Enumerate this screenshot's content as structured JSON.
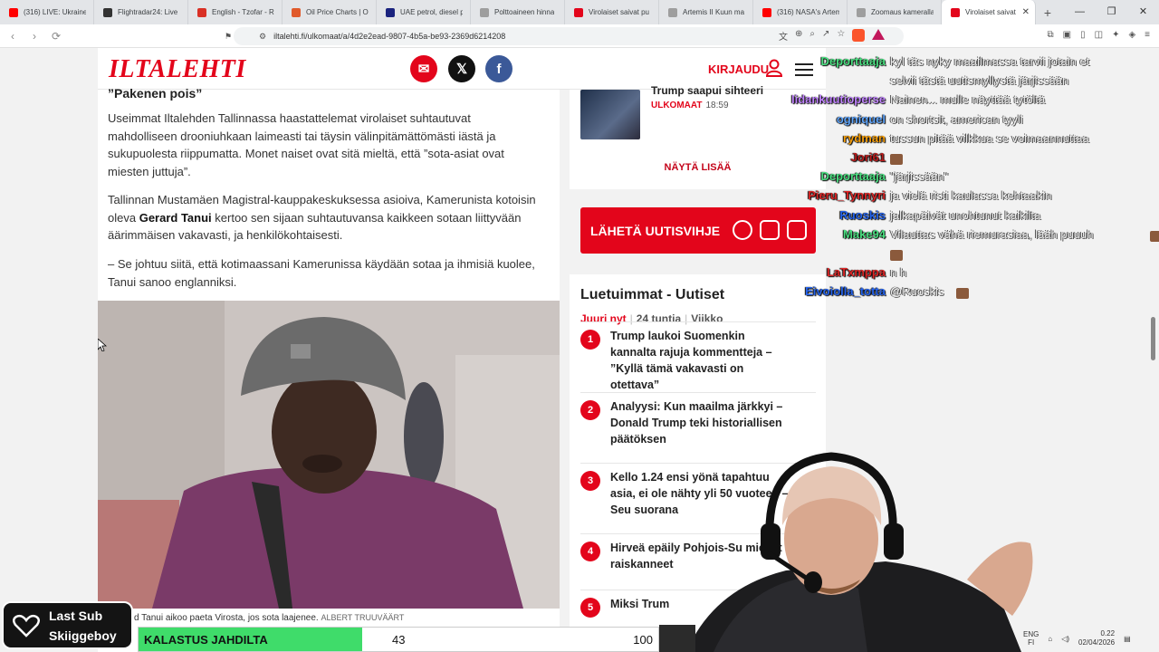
{
  "tabs": [
    {
      "title": "(316) LIVE: Ukraine",
      "fav": "#ff0000"
    },
    {
      "title": "Flightradar24: Live F",
      "fav": "#333333"
    },
    {
      "title": "English - Tzofar - Re",
      "fav": "#d93025"
    },
    {
      "title": "Oil Price Charts | Oil",
      "fav": "#e05a2b"
    },
    {
      "title": "UAE petrol, diesel p",
      "fav": "#1a237e"
    },
    {
      "title": "Polttoaineen hinna",
      "fav": "#9e9e9e"
    },
    {
      "title": "Virolaiset saivat pu",
      "fav": "#e3051b"
    },
    {
      "title": "Artemis II Kuun ma",
      "fav": "#9e9e9e"
    },
    {
      "title": "(316) NASA's Artem",
      "fav": "#ff0000"
    },
    {
      "title": "Zoomaus kameralla",
      "fav": "#9e9e9e"
    },
    {
      "title": "Virolaiset saivat",
      "fav": "#e3051b"
    }
  ],
  "address": {
    "url": "iltalehti.fi/ulkomaat/a/4d2e2ead-9807-4b5a-be93-2369d6214208"
  },
  "site": {
    "logo": "ILTALEHTI",
    "login": "KIRJAUDU"
  },
  "article": {
    "subhead": "”Pakenen pois”",
    "p1": "Useimmat Iltalehden Tallinnassa haastattelemat virolaiset suhtautuvat mahdolliseen drooniuhkaan laimeasti tai täysin välinpitämättömästi iästä ja sukupuolesta riippumatta. Monet naiset ovat sitä mieltä, että ”sota-asiat ovat miesten juttuja”.",
    "p2_before": "Tallinnan Mustamäen Magistral-kauppakeskuksessa asioiva, Kamerunista kotoisin oleva ",
    "p2_name": "Gerard Tanui",
    "p2_after": " kertoo sen sijaan suhtautuvansa kaikkeen sotaan liittyvään äärimmäisen vakavasti, ja henkilökohtaisesti.",
    "p3": "– Se johtuu siitä, että kotimaassani Kamerunissa käydään sotaa ja ihmisiä kuolee, Tanui sanoo englanniksi.",
    "caption_text": "d Tanui aikoo paeta Virosta, jos sota laajenee.",
    "caption_credit": "ALBERT TRUUVÄÄRT"
  },
  "sidebar": {
    "top_title": "Trump saapui sihteeri",
    "top_tag": "ULKOMAAT",
    "top_time": "18:59",
    "more": "NÄYTÄ LISÄÄ",
    "tip": "LÄHETÄ UUTISVIHJE",
    "most_read_title": "Luetuimmat - Uutiset",
    "tabs": [
      "Juuri nyt",
      "24 tuntia",
      "Viikko"
    ],
    "items": [
      {
        "n": "1",
        "text": "Trump laukoi Suomenkin kannalta rajuja kommentteja – ”Kyllä tämä vakavasti on otettava”"
      },
      {
        "n": "2",
        "text": "Analyysi: Kun maailma järkkyi – Donald Trump teki historiallisen päätöksen"
      },
      {
        "n": "3",
        "text": "Kello 1.24 ensi yönä tapahtuu asia, ei ole nähty yli 50 vuoteen – Seu suorana"
      },
      {
        "n": "4",
        "text": "Hirveä epäily Pohjois-Su miehet raiskanneet"
      },
      {
        "n": "5",
        "text": "Miksi Trum"
      }
    ]
  },
  "chat": [
    {
      "user": "Deporttaaja",
      "color": "#4ade80",
      "text": "kyl täs nyky maailmassa tarvii jotain et"
    },
    {
      "user": "",
      "color": "#4ade80",
      "text": "selvii tästä uutismyllystä järjissään"
    },
    {
      "user": "Iidankuutioperse",
      "color": "#c084fc",
      "text": "Nainen... mulle näyttää tytöltä"
    },
    {
      "user": "ogniquel",
      "color": "#60a5fa",
      "text": "on shortsit, american tyyli"
    },
    {
      "user": "rydman",
      "color": "#f59e0b",
      "text": "tussun pitää vilkkua se voimaannuttaa"
    },
    {
      "user": "Jori61",
      "color": "#b91c1c",
      "text": ""
    },
    {
      "user": "Deporttaaja",
      "color": "#4ade80",
      "text": "\"järjissään\""
    },
    {
      "user": "Pieru_Tynnyri",
      "color": "#dc2626",
      "text": "ja vielä risti kaulassa kehtaakin"
    },
    {
      "user": "Ruoskis",
      "color": "#2563eb",
      "text": "jalkapäivät unohtunut kaikilta"
    },
    {
      "user": "Make94",
      "color": "#4ade80",
      "text": "Vilauttas vähä riemurasiaa, lääh puuuh"
    },
    {
      "user": "",
      "color": "#ffffff",
      "text": ""
    },
    {
      "user": "LaTxmppa",
      "color": "#dc2626",
      "text": "n h"
    },
    {
      "user": "Eivoiolla_totta",
      "color": "#2563eb",
      "text": "@Ruoskis"
    }
  ],
  "overlay": {
    "last_sub_label": "Last Sub",
    "last_sub_name": "Skiiggeboy",
    "goal_label": "KALASTUS JAHDILTA",
    "goal_current": "43",
    "goal_max": "100",
    "goal_fraction": 0.43
  },
  "taskbar": {
    "lang1": "ENG",
    "lang2": "FI",
    "time": "0.22",
    "date": "02/04/2026"
  }
}
